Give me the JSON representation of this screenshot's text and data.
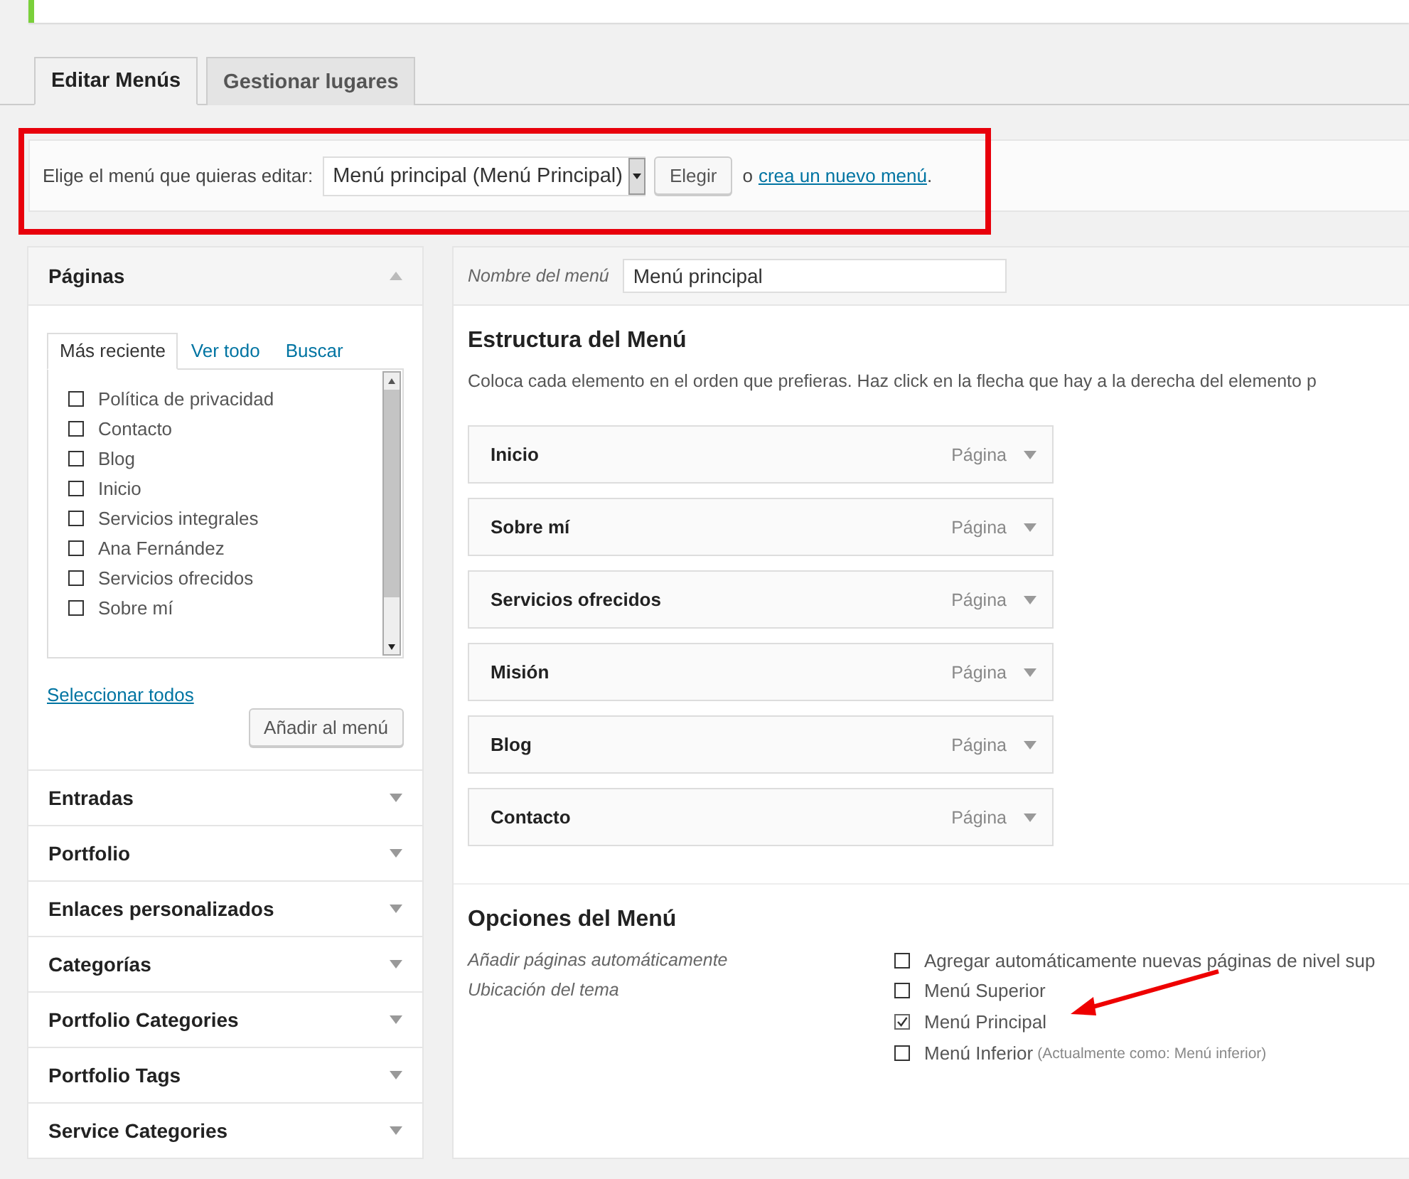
{
  "tabs": [
    {
      "label": "Editar Menús",
      "selected": true
    },
    {
      "label": "Gestionar lugares",
      "selected": false
    }
  ],
  "menu_select": {
    "label": "Elige el menú que quieras editar:",
    "value": "Menú principal (Menú Principal)",
    "button": "Elegir",
    "separator": "o",
    "link": "crea un nuevo menú",
    "link_suffix": "."
  },
  "sidebar": {
    "panels": [
      {
        "title": "Páginas",
        "expanded": true,
        "tabs": [
          {
            "label": "Más reciente",
            "selected": true
          },
          {
            "label": "Ver todo",
            "selected": false
          },
          {
            "label": "Buscar",
            "selected": false
          }
        ],
        "items": [
          {
            "label": "Política de privacidad",
            "checked": false
          },
          {
            "label": "Contacto",
            "checked": false
          },
          {
            "label": "Blog",
            "checked": false
          },
          {
            "label": "Inicio",
            "checked": false
          },
          {
            "label": "Servicios integrales",
            "checked": false
          },
          {
            "label": "Ana Fernández",
            "checked": false
          },
          {
            "label": "Servicios ofrecidos",
            "checked": false
          },
          {
            "label": "Sobre mí",
            "checked": false
          }
        ],
        "select_all": "Seleccionar todos",
        "add_button": "Añadir al menú"
      },
      {
        "title": "Entradas",
        "expanded": false
      },
      {
        "title": "Portfolio",
        "expanded": false
      },
      {
        "title": "Enlaces personalizados",
        "expanded": false
      },
      {
        "title": "Categorías",
        "expanded": false
      },
      {
        "title": "Portfolio Categories",
        "expanded": false
      },
      {
        "title": "Portfolio Tags",
        "expanded": false
      },
      {
        "title": "Service Categories",
        "expanded": false
      }
    ]
  },
  "menu_editor": {
    "name_label": "Nombre del menú",
    "name_value": "Menú principal",
    "structure_title": "Estructura del Menú",
    "structure_hint": "Coloca cada elemento en el orden que prefieras. Haz click en la flecha que hay a la derecha del elemento p",
    "items": [
      {
        "title": "Inicio",
        "type": "Página"
      },
      {
        "title": "Sobre mí",
        "type": "Página"
      },
      {
        "title": "Servicios ofrecidos",
        "type": "Página"
      },
      {
        "title": "Misión",
        "type": "Página"
      },
      {
        "title": "Blog",
        "type": "Página"
      },
      {
        "title": "Contacto",
        "type": "Página"
      }
    ],
    "options_title": "Opciones del Menú",
    "options": [
      {
        "label": "Añadir páginas automáticamente",
        "choices": [
          {
            "label": "Agregar automáticamente nuevas páginas de nivel sup",
            "checked": false
          }
        ]
      },
      {
        "label": "Ubicación del tema",
        "choices": [
          {
            "label": "Menú Superior",
            "checked": false
          },
          {
            "label": "Menú Principal",
            "checked": true
          },
          {
            "label": "Menú Inferior",
            "note": "(Actualmente como: Menú inferior)",
            "checked": false
          }
        ]
      }
    ]
  }
}
